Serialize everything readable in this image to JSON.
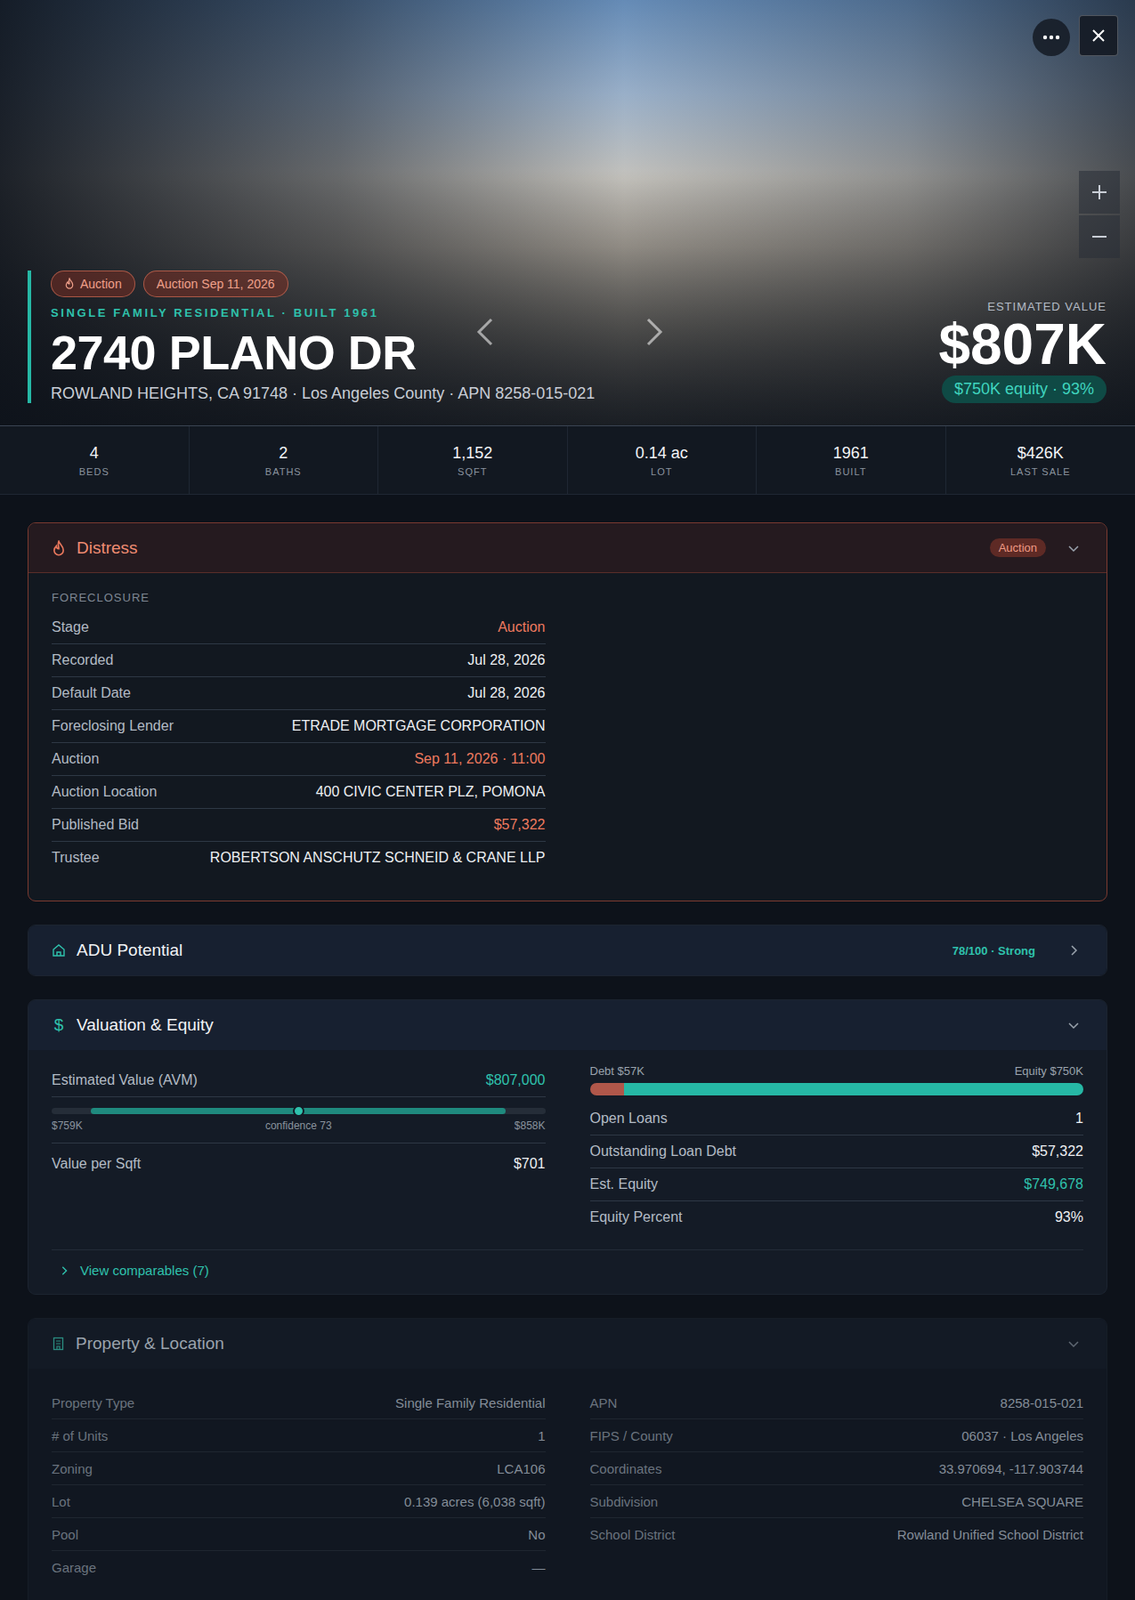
{
  "hero": {
    "badges": [
      {
        "label": "Auction",
        "icon": true
      },
      {
        "label": "Auction Sep 11, 2026",
        "icon": false
      }
    ],
    "type_line": "SINGLE FAMILY RESIDENTIAL · BUILT 1961",
    "address": "2740 PLANO DR",
    "location": "ROWLAND HEIGHTS, CA 91748 · Los Angeles County · APN 8258-015-021",
    "value_label": "ESTIMATED VALUE",
    "value": "$807K",
    "equity_pill": "$750K equity · 93%"
  },
  "stats": [
    {
      "value": "4",
      "label": "BEDS"
    },
    {
      "value": "2",
      "label": "BATHS"
    },
    {
      "value": "1,152",
      "label": "SQFT"
    },
    {
      "value": "0.14 ac",
      "label": "LOT"
    },
    {
      "value": "1961",
      "label": "BUILT"
    },
    {
      "value": "$426K",
      "label": "LAST SALE"
    }
  ],
  "distress": {
    "title": "Distress",
    "badge": "Auction",
    "expanded": true,
    "section": "FORECLOSURE",
    "rows": [
      {
        "label": "Stage",
        "value": "Auction",
        "highlight": true
      },
      {
        "label": "Recorded",
        "value": "Jul 28, 2026",
        "highlight": false
      },
      {
        "label": "Default Date",
        "value": "Jul 28, 2026",
        "highlight": false
      },
      {
        "label": "Foreclosing Lender",
        "value": "ETRADE MORTGAGE CORPORATION",
        "highlight": false
      },
      {
        "label": "Auction",
        "value": "Sep 11, 2026 · 11:00",
        "highlight": true
      },
      {
        "label": "Auction Location",
        "value": "400 CIVIC CENTER PLZ, POMONA",
        "highlight": false
      },
      {
        "label": "Published Bid",
        "value": "$57,322",
        "highlight": true
      },
      {
        "label": "Trustee",
        "value": "ROBERTSON ANSCHUTZ SCHNEID & CRANE LLP",
        "highlight": false
      }
    ]
  },
  "adu": {
    "title": "ADU Potential",
    "score": "78/100 · Strong"
  },
  "valuation": {
    "icon": "$",
    "title": "Valuation & Equity",
    "expanded": true,
    "avm_label": "Estimated Value (AVM)",
    "avm_value": "$807,000",
    "range": {
      "low": "$759K",
      "mid": "confidence 73",
      "high": "$858K",
      "fill_start": 0.08,
      "fill_end": 0.92,
      "level": 0.5
    },
    "per_sqft_label": "Value per Sqft",
    "per_sqft_value": "$701",
    "debt_label": "Debt $57K",
    "equity_label": "Equity $750K",
    "debt_level": 0.07,
    "rows": [
      {
        "label": "Open Loans",
        "value": "1",
        "tone": "normal"
      },
      {
        "label": "Outstanding Loan Debt",
        "value": "$57,322",
        "tone": "normal"
      },
      {
        "label": "Est. Equity",
        "value": "$749,678",
        "tone": "positive"
      },
      {
        "label": "Equity Percent",
        "value": "93%",
        "tone": "normal"
      }
    ],
    "comparables": "View comparables (7)"
  },
  "property": {
    "title": "Property & Location",
    "expanded": true,
    "left": [
      {
        "label": "Property Type",
        "value": "Single Family Residential"
      },
      {
        "label": "# of Units",
        "value": "1"
      },
      {
        "label": "Zoning",
        "value": "LCA106"
      },
      {
        "label": "Lot",
        "value": "0.139 acres (6,038 sqft)"
      },
      {
        "label": "Pool",
        "value": "No"
      },
      {
        "label": "Garage",
        "value": "—"
      }
    ],
    "right": [
      {
        "label": "APN",
        "value": "8258-015-021"
      },
      {
        "label": "FIPS / County",
        "value": "06037 · Los Angeles"
      },
      {
        "label": "Coordinates",
        "value": "33.970694, -117.903744"
      },
      {
        "label": "Subdivision",
        "value": "CHELSEA SQUARE"
      },
      {
        "label": "School District",
        "value": "Rowland Unified School District"
      }
    ]
  }
}
